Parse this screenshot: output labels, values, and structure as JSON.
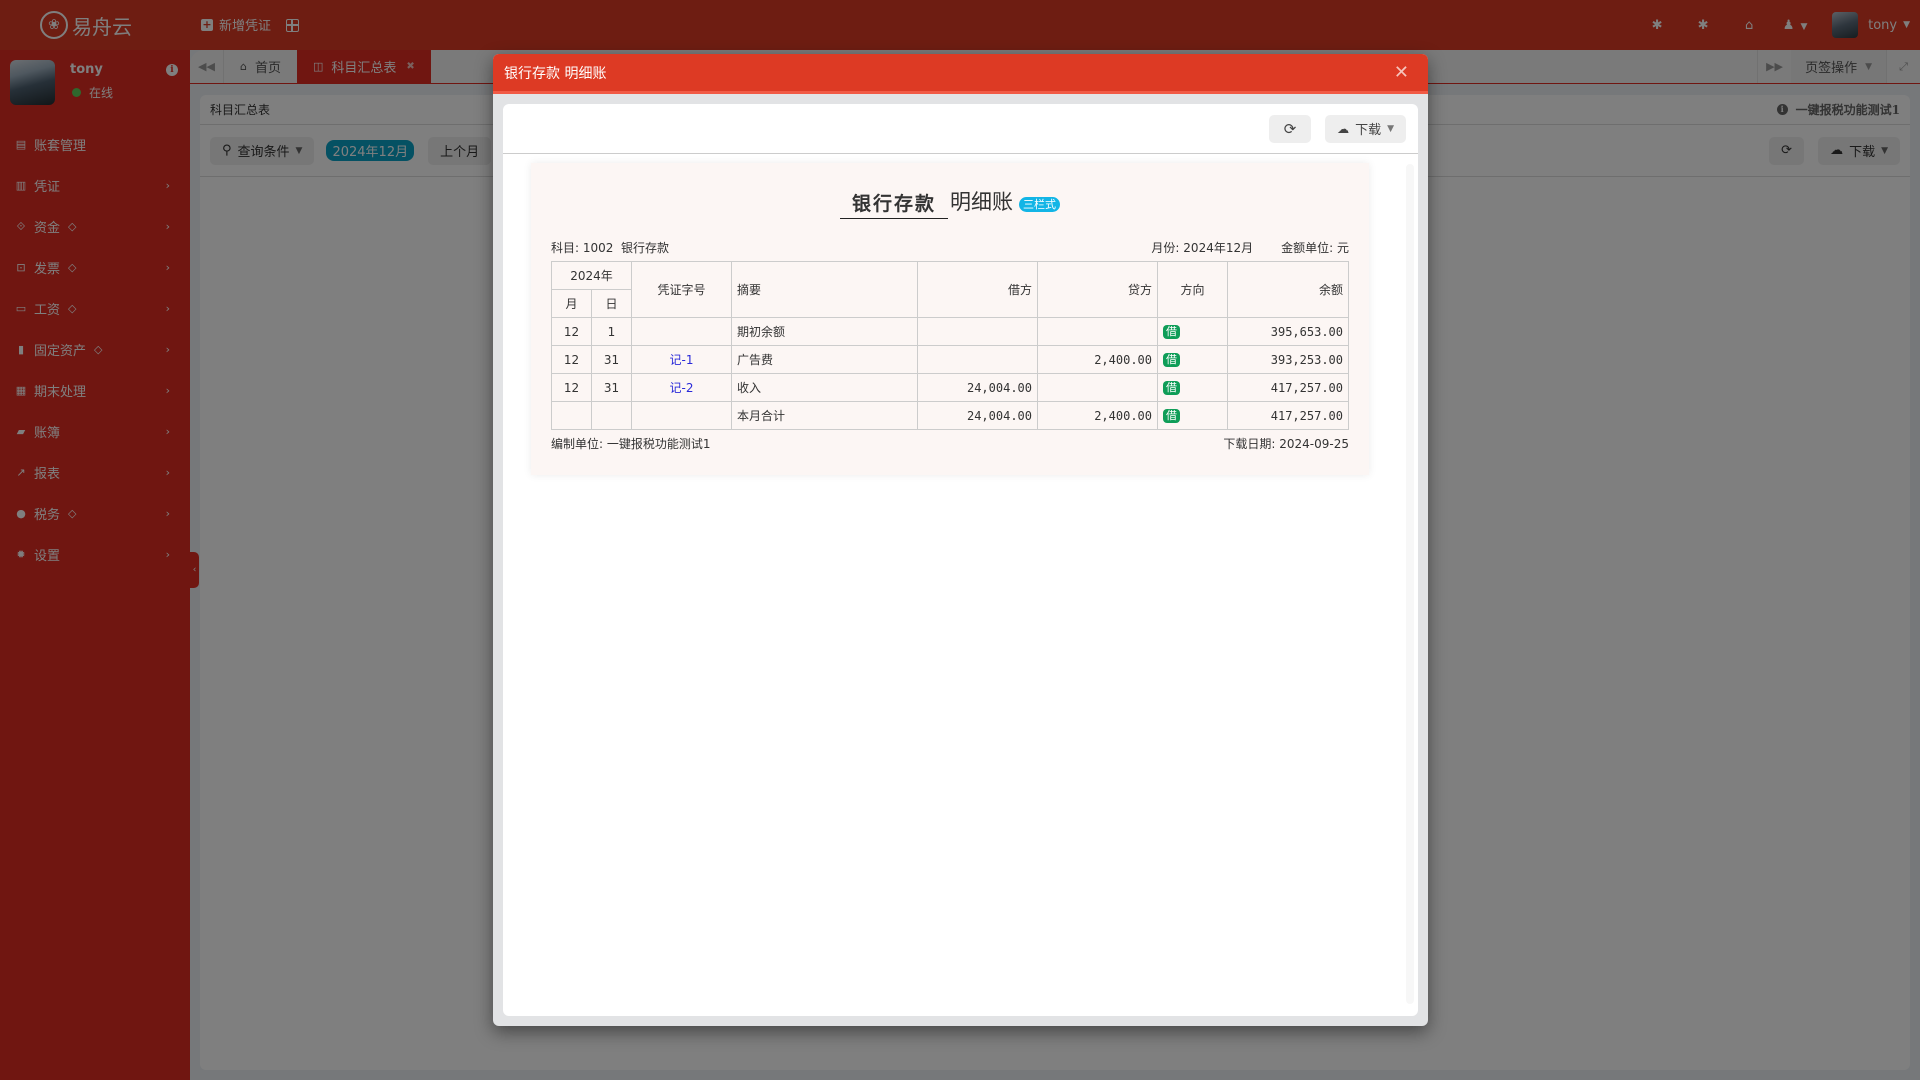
{
  "app": {
    "logo_text": "易舟云",
    "new_voucher_label": "新增凭证",
    "user_name": "tony"
  },
  "topbar_icons": [
    "bug-icon",
    "bug-icon",
    "home-icon",
    "user-menu-icon"
  ],
  "sidebar": {
    "user": {
      "name": "tony",
      "status": "在线"
    },
    "items": [
      {
        "label": "账套管理",
        "icon": "archive-icon",
        "premium": false,
        "has_children": false
      },
      {
        "label": "凭证",
        "icon": "voucher-icon",
        "premium": false,
        "has_children": true
      },
      {
        "label": "资金",
        "icon": "link-icon",
        "premium": true,
        "has_children": true
      },
      {
        "label": "发票",
        "icon": "invoice-icon",
        "premium": true,
        "has_children": true
      },
      {
        "label": "工资",
        "icon": "card-icon",
        "premium": true,
        "has_children": true
      },
      {
        "label": "固定资产",
        "icon": "building-icon",
        "premium": true,
        "has_children": true
      },
      {
        "label": "期末处理",
        "icon": "calendar-icon",
        "premium": false,
        "has_children": true
      },
      {
        "label": "账簿",
        "icon": "book-icon",
        "premium": false,
        "has_children": true
      },
      {
        "label": "报表",
        "icon": "chart-icon",
        "premium": false,
        "has_children": true
      },
      {
        "label": "税务",
        "icon": "tax-icon",
        "premium": true,
        "has_children": true
      },
      {
        "label": "设置",
        "icon": "gear-icon",
        "premium": false,
        "has_children": true
      }
    ]
  },
  "tabs": {
    "items": [
      {
        "label": "首页",
        "active": false,
        "closable": false
      },
      {
        "label": "科目汇总表",
        "active": true,
        "closable": true
      }
    ],
    "ops_label": "页签操作"
  },
  "page": {
    "title": "科目汇总表",
    "company": "一键报税功能测试1",
    "query_label": "查询条件",
    "period": "2024年12月",
    "prev_month_label": "上个月",
    "download_label": "下载"
  },
  "modal": {
    "title": "银行存款 明细账",
    "download_label": "下载",
    "ledger": {
      "account_name": "银行存款",
      "ledger_type": "明细账",
      "format_badge": "三栏式",
      "subject_label": "科目:",
      "subject_value": "1002  银行存款",
      "month_label": "月份:",
      "month_value": "2024年12月",
      "unit_label": "金额单位:",
      "unit_value": "元",
      "headers": {
        "year": "2024年",
        "month": "月",
        "day": "日",
        "voucher": "凭证字号",
        "summary": "摘要",
        "debit": "借方",
        "credit": "贷方",
        "direction": "方向",
        "balance": "余额"
      },
      "rows": [
        {
          "month": "12",
          "day": "1",
          "voucher": "",
          "summary": "期初余额",
          "debit": "",
          "credit": "",
          "direction": "借",
          "balance": "395,653.00"
        },
        {
          "month": "12",
          "day": "31",
          "voucher": "记-1",
          "summary": "广告费",
          "debit": "",
          "credit": "2,400.00",
          "direction": "借",
          "balance": "393,253.00"
        },
        {
          "month": "12",
          "day": "31",
          "voucher": "记-2",
          "summary": "收入",
          "debit": "24,004.00",
          "credit": "",
          "direction": "借",
          "balance": "417,257.00"
        },
        {
          "month": "",
          "day": "",
          "voucher": "",
          "summary": "本月合计",
          "debit": "24,004.00",
          "credit": "2,400.00",
          "direction": "借",
          "balance": "417,257.00"
        }
      ],
      "prepared_by_label": "编制单位:",
      "prepared_by_value": "一键报税功能测试1",
      "download_date_label": "下载日期:",
      "download_date_value": "2024-09-25"
    }
  }
}
